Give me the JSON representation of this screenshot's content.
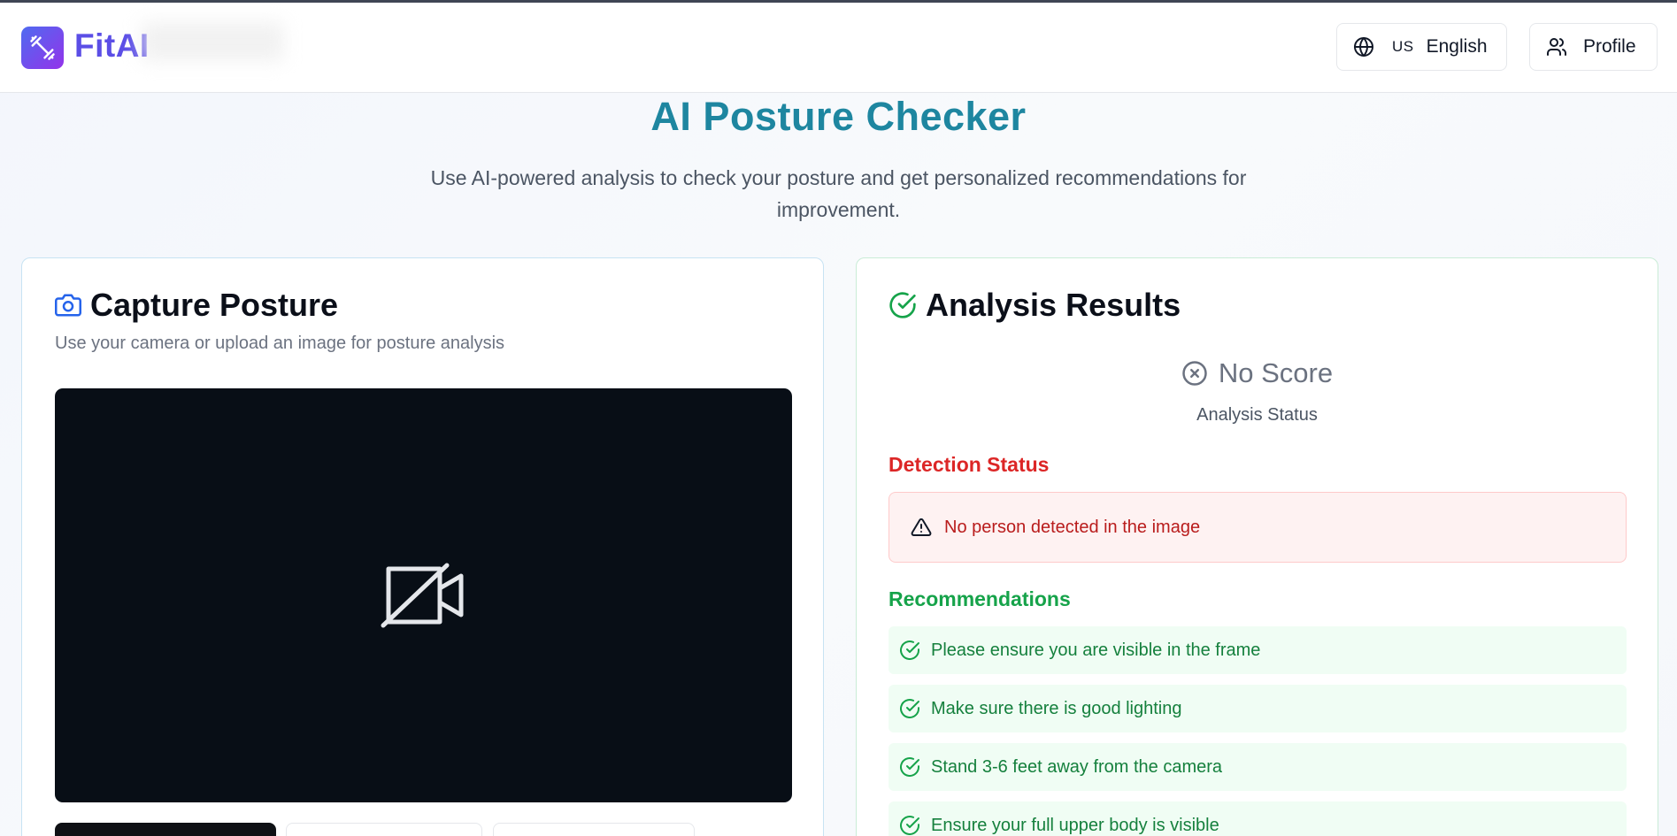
{
  "header": {
    "app_name": "FitAI",
    "language": {
      "flag": "US",
      "label": "English"
    },
    "profile_label": "Profile"
  },
  "hero": {
    "title": "AI Posture Checker",
    "subtitle": "Use AI-powered analysis to check your posture and get personalized recommendations for improvement."
  },
  "capture": {
    "title": "Capture Posture",
    "description": "Use your camera or upload an image for posture analysis"
  },
  "results": {
    "title": "Analysis Results",
    "score_label": "No Score",
    "score_sub": "Analysis Status",
    "detection_heading": "Detection Status",
    "detection_message": "No person detected in the image",
    "recommendations_heading": "Recommendations",
    "recommendations": [
      "Please ensure you are visible in the frame",
      "Make sure there is good lighting",
      "Stand 3-6 feet away from the camera",
      "Ensure your full upper body is visible"
    ]
  },
  "colors": {
    "brand_gradient_start": "#4f6bf0",
    "brand_gradient_end": "#9333ea",
    "hero_title": "#1e86a0",
    "error": "#dc2626",
    "success": "#16a34a"
  },
  "icons": {
    "logo": "dumbbell-icon",
    "language": "globe-icon",
    "profile": "users-icon",
    "capture": "camera-icon",
    "results": "check-circle-icon",
    "score": "x-circle-icon",
    "alert": "alert-triangle-icon",
    "video": "video-off-icon",
    "recommendation": "check-circle-icon"
  }
}
